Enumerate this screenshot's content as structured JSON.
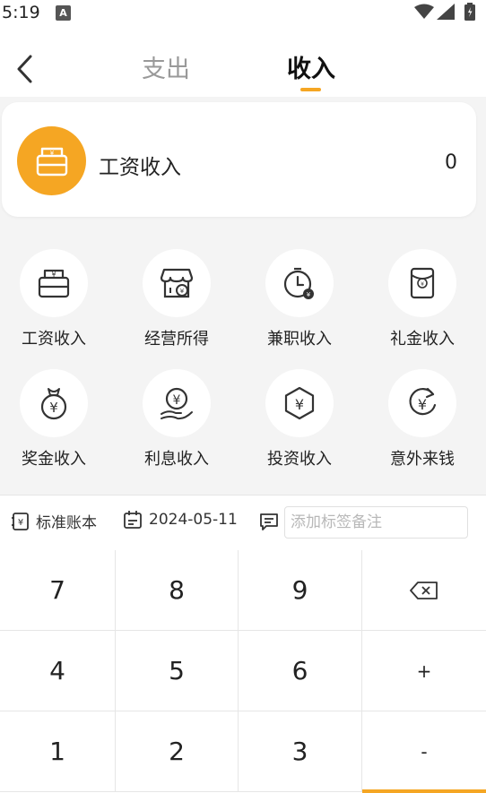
{
  "status_bar": {
    "time": "5:19",
    "notification_icon": "A"
  },
  "header": {
    "tabs": [
      {
        "label": "支出",
        "active": false
      },
      {
        "label": "收入",
        "active": true
      }
    ]
  },
  "selected": {
    "label": "工资收入",
    "amount": "0",
    "icon": "wallet-icon",
    "accent_color": "#f5a623"
  },
  "categories": [
    {
      "label": "工资收入",
      "icon": "wallet-icon"
    },
    {
      "label": "经营所得",
      "icon": "shop-icon"
    },
    {
      "label": "兼职收入",
      "icon": "clock-money-icon"
    },
    {
      "label": "礼金收入",
      "icon": "red-envelope-icon"
    },
    {
      "label": "奖金收入",
      "icon": "money-bag-icon"
    },
    {
      "label": "利息收入",
      "icon": "coin-hand-icon"
    },
    {
      "label": "投资收入",
      "icon": "hexagon-yuan-icon"
    },
    {
      "label": "意外来钱",
      "icon": "refresh-yuan-icon"
    }
  ],
  "toolbar": {
    "book": "标准账本",
    "date": "2024-05-11",
    "note_placeholder": "添加标签备注"
  },
  "keypad": {
    "row1": [
      "7",
      "8",
      "9"
    ],
    "row2": [
      "4",
      "5",
      "6",
      "+"
    ],
    "row3": [
      "1",
      "2",
      "3",
      "-"
    ]
  }
}
